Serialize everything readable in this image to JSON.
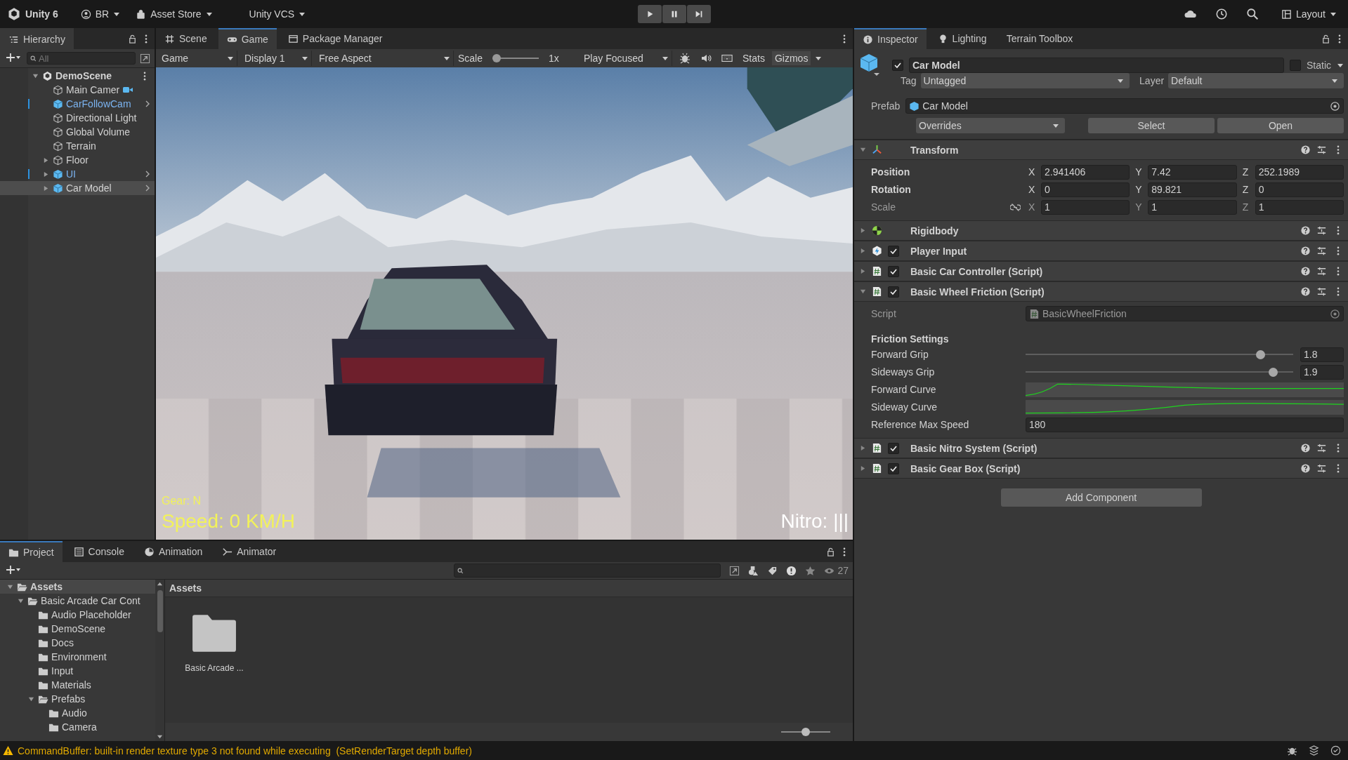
{
  "toolbar": {
    "product": "Unity 6",
    "account": "BR",
    "asset_store": "Asset Store",
    "vcs": "Unity VCS",
    "layout": "Layout"
  },
  "hierarchy": {
    "tab": "Hierarchy",
    "search_placeholder": "All",
    "tree": [
      {
        "name": "DemoScene",
        "kind": "scene",
        "expanded": true,
        "selected": false,
        "modified": false,
        "gizmo": false,
        "children": [
          {
            "name": "Main Camer",
            "kind": "object",
            "selected": false,
            "modified": false,
            "gizmo": true
          },
          {
            "name": "CarFollowCam",
            "kind": "prefab",
            "selected": false,
            "modified": true,
            "gizmo": false
          },
          {
            "name": "Directional Light",
            "kind": "object",
            "selected": false,
            "modified": false,
            "gizmo": false
          },
          {
            "name": "Global Volume",
            "kind": "object",
            "selected": false,
            "modified": false,
            "gizmo": false
          },
          {
            "name": "Terrain",
            "kind": "object",
            "selected": false,
            "modified": false,
            "gizmo": false
          },
          {
            "name": "Floor",
            "kind": "object",
            "expanded": false,
            "selected": false,
            "modified": false,
            "gizmo": false
          },
          {
            "name": "UI",
            "kind": "prefab",
            "expanded": false,
            "selected": false,
            "modified": true,
            "gizmo": false
          },
          {
            "name": "Car Model",
            "kind": "prefab",
            "expanded": false,
            "selected": true,
            "modified": false,
            "gizmo": false
          }
        ]
      }
    ]
  },
  "scene_tabs": [
    {
      "label": "Scene",
      "kind": "scene",
      "selected": false
    },
    {
      "label": "Game",
      "kind": "game",
      "selected": true
    },
    {
      "label": "Package Manager",
      "kind": "package",
      "selected": false
    }
  ],
  "game_toolbar": {
    "view": "Game",
    "display": "Display 1",
    "aspect": "Free Aspect",
    "scale_label": "Scale",
    "scale": {
      "level": 0
    },
    "scale_value": "1x",
    "play_mode": "Play Focused",
    "stats": "Stats",
    "gizmos": "Gizmos"
  },
  "hud": {
    "gear": "Gear: N",
    "speed": "Speed: 0 KM/H",
    "nitro": "Nitro: |||"
  },
  "inspector": {
    "tabs": [
      {
        "label": "Inspector",
        "kind": "info",
        "selected": true
      },
      {
        "label": "Lighting",
        "kind": "bulb",
        "selected": false
      },
      {
        "label": "Terrain Toolbox",
        "kind": "none",
        "selected": false
      }
    ],
    "object": {
      "name": "Car Model",
      "active": true,
      "static": false,
      "static_label": "Static",
      "tag_label": "Tag",
      "tag": "Untagged",
      "layer_label": "Layer",
      "layer": "Default",
      "prefab_label": "Prefab",
      "prefab": "Car Model",
      "overrides": "Overrides",
      "select": "Select",
      "open": "Open"
    },
    "components": [
      {
        "title": "Transform",
        "kind": "transform",
        "expanded": true,
        "rows": [
          {
            "label": "Position",
            "kind": "vector",
            "overridden": true,
            "values": [
              {
                "axis": "X",
                "value": "2.941406"
              },
              {
                "axis": "Y",
                "value": "7.42"
              },
              {
                "axis": "Z",
                "value": "252.1989"
              }
            ]
          },
          {
            "label": "Rotation",
            "kind": "vector",
            "overridden": true,
            "values": [
              {
                "axis": "X",
                "value": "0"
              },
              {
                "axis": "Y",
                "value": "89.821"
              },
              {
                "axis": "Z",
                "value": "0"
              }
            ]
          },
          {
            "label": "Scale",
            "kind": "scale",
            "overridden": false,
            "values": [
              {
                "axis": "X",
                "value": "1"
              },
              {
                "axis": "Y",
                "value": "1"
              },
              {
                "axis": "Z",
                "value": "1"
              }
            ]
          }
        ]
      },
      {
        "title": "Rigidbody",
        "kind": "rigidbody",
        "expanded": false
      },
      {
        "title": "Player Input",
        "kind": "input",
        "expanded": false,
        "enabled": true
      },
      {
        "title": "Basic Car Controller (Script)",
        "kind": "script",
        "expanded": false,
        "enabled": true
      },
      {
        "title": "Basic Wheel Friction (Script)",
        "kind": "script",
        "expanded": true,
        "enabled": true,
        "script_label": "Script",
        "script": "BasicWheelFriction",
        "section": "Friction Settings",
        "fields": [
          {
            "kind": "slider",
            "label": "Forward Grip",
            "level": 0.89,
            "value": "1.8"
          },
          {
            "kind": "slider",
            "label": "Sideways Grip",
            "level": 0.94,
            "value": "1.9"
          },
          {
            "kind": "curve",
            "label": "Forward Curve"
          },
          {
            "kind": "curve",
            "label": "Sideway Curve"
          },
          {
            "kind": "number",
            "label": "Reference Max Speed",
            "value": "180"
          }
        ]
      },
      {
        "title": "Basic Nitro System (Script)",
        "kind": "script",
        "expanded": false,
        "enabled": true
      },
      {
        "title": "Basic Gear Box (Script)",
        "kind": "script",
        "expanded": false,
        "enabled": true
      }
    ],
    "add_component": "Add Component"
  },
  "bottom_tabs": [
    {
      "label": "Project",
      "kind": "folder",
      "selected": true
    },
    {
      "label": "Console",
      "kind": "console",
      "selected": false
    },
    {
      "label": "Animation",
      "kind": "clock",
      "selected": false
    },
    {
      "label": "Animator",
      "kind": "graph",
      "selected": false
    }
  ],
  "project": {
    "visible_count": "27",
    "tree": [
      {
        "name": "Assets",
        "expanded": true,
        "selected": true,
        "children": [
          {
            "name": "Basic Arcade Car Cont",
            "expanded": true,
            "selected": false,
            "children": [
              {
                "name": "Audio Placeholder",
                "selected": false
              },
              {
                "name": "DemoScene",
                "selected": false
              },
              {
                "name": "Docs",
                "selected": false
              },
              {
                "name": "Environment",
                "selected": false
              },
              {
                "name": "Input",
                "selected": false
              },
              {
                "name": "Materials",
                "selected": false
              },
              {
                "name": "Prefabs",
                "expanded": true,
                "selected": false,
                "children": [
                  {
                    "name": "Audio",
                    "selected": false
                  },
                  {
                    "name": "Camera",
                    "selected": false
                  }
                ]
              }
            ]
          }
        ]
      }
    ],
    "breadcrumb": "Assets",
    "items": [
      {
        "name": "Basic Arcade ...",
        "kind": "folder"
      }
    ],
    "zoom": {
      "level": 0.5
    }
  },
  "status": {
    "kind": "warning",
    "message": "CommandBuffer: built-in render texture type 3 not found while executing  (SetRenderTarget depth buffer)"
  }
}
